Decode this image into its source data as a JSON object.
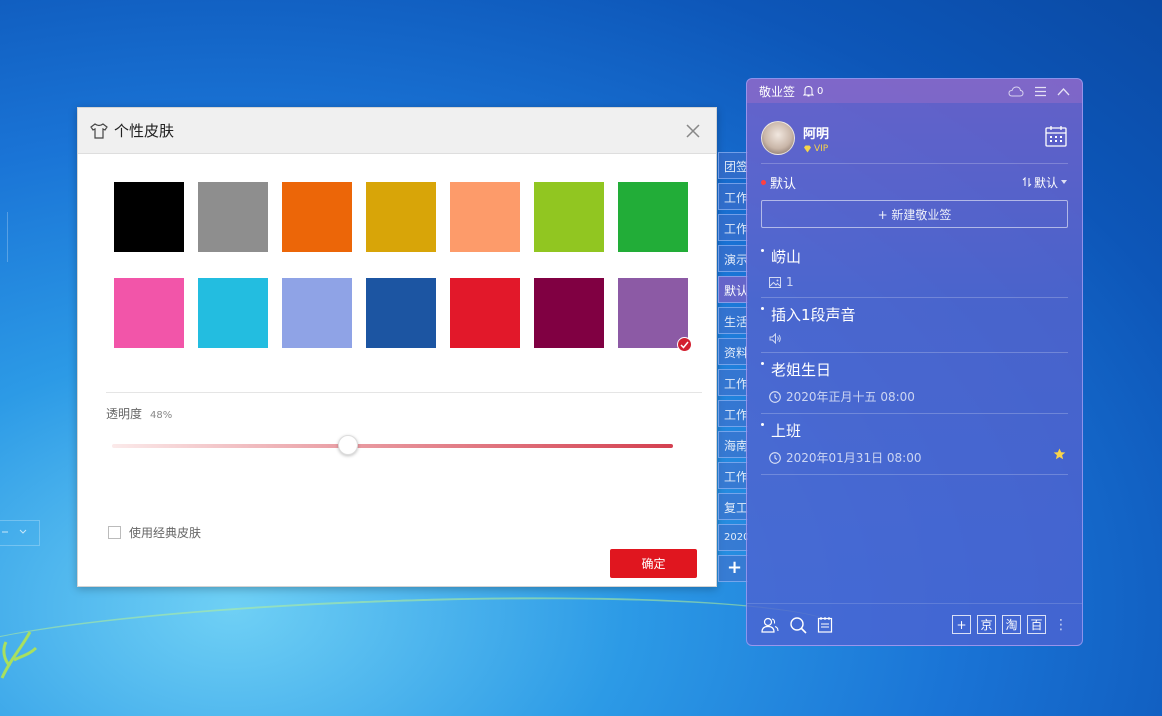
{
  "skin_dialog": {
    "title": "个性皮肤",
    "swatches": [
      "#000000",
      "#8e8e8e",
      "#ec6608",
      "#d8a508",
      "#fd9b6a",
      "#91c621",
      "#22ad38",
      "#f255a9",
      "#23bde0",
      "#8fa3e6",
      "#1c55a2",
      "#e2182a",
      "#800042",
      "#8c5aa5"
    ],
    "selected_index": 13,
    "opacity_label": "透明度",
    "opacity_value": "48%",
    "opacity_fraction": 0.42,
    "classic_skin_label": "使用经典皮肤",
    "ok_label": "确定"
  },
  "category_tabs": [
    "团签",
    "工作",
    "工作",
    "演示",
    "默认",
    "生活",
    "资料",
    "工作",
    "工作",
    "海南",
    "工作",
    "复工",
    "2020"
  ],
  "active_tab_index": 4,
  "app": {
    "name": "敬业签",
    "reminder_count": "0",
    "user_name": "阿明",
    "vip_label": "VIP",
    "group_name": "默认",
    "sort_label": "默认",
    "new_note_label": "+ 新建敬业签",
    "notes": [
      {
        "title": "崂山",
        "meta": "1",
        "meta_icon": "image-icon",
        "starred": false
      },
      {
        "title": "插入1段声音",
        "meta": "",
        "meta_icon": "speaker-icon",
        "starred": false
      },
      {
        "title": "老姐生日",
        "meta": "2020年正月十五 08:00",
        "meta_icon": "clock-icon",
        "starred": false
      },
      {
        "title": "上班",
        "meta": "2020年01月31日 08:00",
        "meta_icon": "clock-icon",
        "starred": true
      }
    ],
    "bottom_shortcuts": [
      "+",
      "京",
      "淘",
      "百"
    ],
    "accent_color": "#e0161f"
  }
}
